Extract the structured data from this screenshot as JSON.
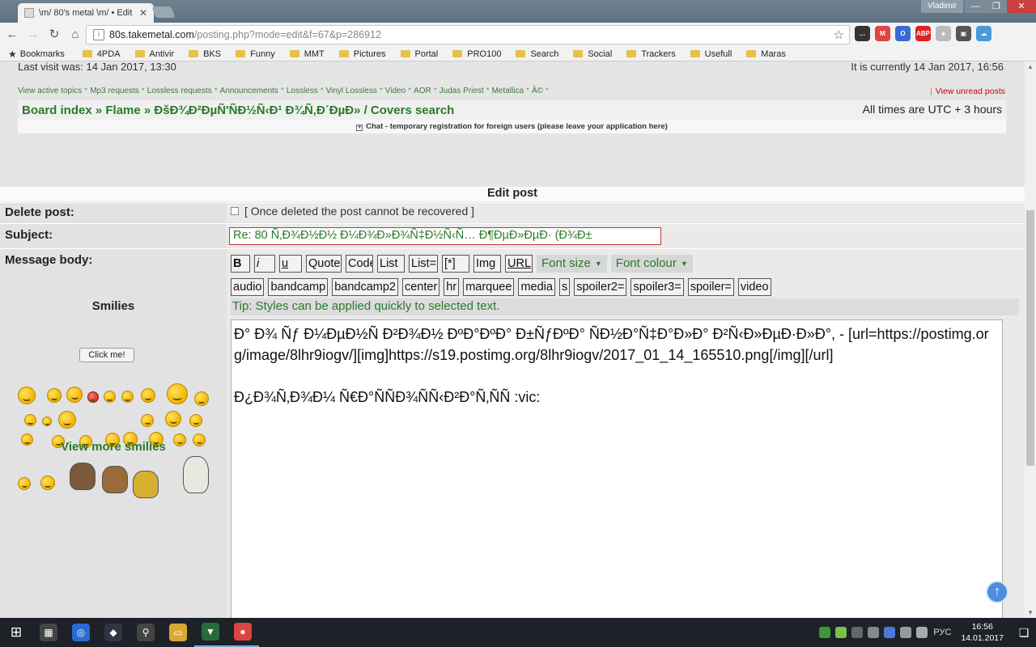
{
  "window": {
    "tab_title": "\\m/ 80's metal \\m/ • Edit",
    "user": "Vladimir",
    "min": "—",
    "max": "❐",
    "close": "✕"
  },
  "toolbar": {
    "back": "←",
    "forward": "→",
    "reload": "↻",
    "home": "⌂",
    "url_host": "80s.takemetal.com",
    "url_path": "/posting.php?mode=edit&f=67&p=286912",
    "star": "☆",
    "extensions": [
      {
        "name": "hangouts-icon",
        "color": "#333",
        "label": "…"
      },
      {
        "name": "gmail-icon",
        "color": "#d44",
        "label": "M"
      },
      {
        "name": "browser-ext-icon",
        "color": "#3a6ad4",
        "label": "O"
      },
      {
        "name": "adblock-icon",
        "color": "#d22",
        "label": "ABP"
      },
      {
        "name": "shield-icon",
        "color": "#bbb",
        "label": "◈"
      },
      {
        "name": "monitor-ext-icon",
        "color": "#555",
        "label": "▣"
      },
      {
        "name": "weather-icon",
        "color": "#4a9ad8",
        "label": "☁"
      }
    ]
  },
  "bookmarks": {
    "label": "Bookmarks",
    "items": [
      "4PDA",
      "Antivir",
      "BKS",
      "Funny",
      "MMT",
      "Pictures",
      "Portal",
      "PRO100",
      "Search",
      "Social",
      "Trackers",
      "Usefull",
      "Maras"
    ]
  },
  "header": {
    "last_visit": "Last visit was: 14 Jan 2017, 13:30",
    "current_time": "It is currently 14 Jan 2017, 16:56",
    "quick_links": [
      "View active topics",
      "Mp3 requests",
      "Lossless requests",
      "Announcements",
      "Lossless",
      "Vinyl Lossless",
      "Video",
      "AOR",
      "Judas Priest",
      "Metallica",
      "Â©"
    ],
    "quick_sep": "*",
    "unread_sep": "|",
    "unread": "View unread posts",
    "breadcrumb": "Board index » Flame » ÐšÐ¾Ð²ÐµÑ'ÑÐ½Ñ‹Ð¹ Ð¾Ñ‚Ð´ÐµÐ» / Covers search",
    "timezone": "All times are UTC + 3 hours",
    "chat_plus": "+",
    "chat": "Chat - temporary registration for foreign users (please leave your application here)"
  },
  "form": {
    "title": "Edit post",
    "delete_label": "Delete post:",
    "delete_note": "[ Once deleted the post cannot be recovered ]",
    "subject_label": "Subject:",
    "subject_value": "Re: 80 Ñ‚Ð¾Ð½Ð½ Ð¼Ð¾Ð»Ð¾Ñ‡Ð½Ñ‹Ñ… Ð¶ÐµÐ»ÐµÐ· (Ð¾Ð±",
    "message_label": "Message body:",
    "buttons_row1": [
      "B",
      "i",
      "u",
      "Quote",
      "Code",
      "List",
      "List=",
      "[*]",
      "Img",
      "URL"
    ],
    "font_size": "Font size",
    "font_colour": "Font colour",
    "dd_arrow": "▼",
    "buttons_row2": [
      "audio",
      "bandcamp",
      "bandcamp2",
      "center",
      "hr",
      "marquee",
      "media",
      "s",
      "spoiler2=",
      "spoiler3=",
      "spoiler=",
      "video"
    ],
    "tip": "Tip: Styles can be applied quickly to selected text.",
    "message": "Ð° Ð¾ Ñƒ Ð¼ÐµÐ½Ñ Ð²Ð¾Ð½ ÐºÐ°ÐºÐ° Ð±ÑƒÐºÐ° ÑÐ½Ð°Ñ‡Ð°Ð»Ð° Ð²Ñ‹Ð»ÐµÐ·Ð»Ð°, - [url=https://postimg.org/image/8lhr9iogv/][img]https://s19.postimg.org/8lhr9iogv/2017_01_14_165510.png[/img][/url]\n\nÐ¿Ð¾Ñ‚Ð¾Ð¼ Ñ€Ð°ÑÑÐ¾ÑÑ‹Ð²Ð°Ñ‚ÑÑ :vic:"
  },
  "smilies": {
    "title": "Smilies",
    "click_me": "Click me!",
    "view_more": "View more smilies"
  },
  "scroll_top": "↑",
  "taskbar": {
    "start": "⊞",
    "apps": [
      {
        "name": "calculator-app",
        "glyph": "▦",
        "color": "#444"
      },
      {
        "name": "browser-app",
        "glyph": "◎",
        "color": "#2a6ad4"
      },
      {
        "name": "vpn-app",
        "glyph": "◆",
        "color": "#334"
      },
      {
        "name": "search-app",
        "glyph": "⚲",
        "color": "#444"
      },
      {
        "name": "file-explorer-app",
        "glyph": "▭",
        "color": "#d8a830"
      },
      {
        "name": "media-app",
        "glyph": "▼",
        "color": "#2a6a3a"
      },
      {
        "name": "chrome-app",
        "glyph": "●",
        "color": "#d44"
      }
    ],
    "lang": "РУС",
    "time": "16:56",
    "date": "14.01.2017",
    "notifications": "❏"
  }
}
